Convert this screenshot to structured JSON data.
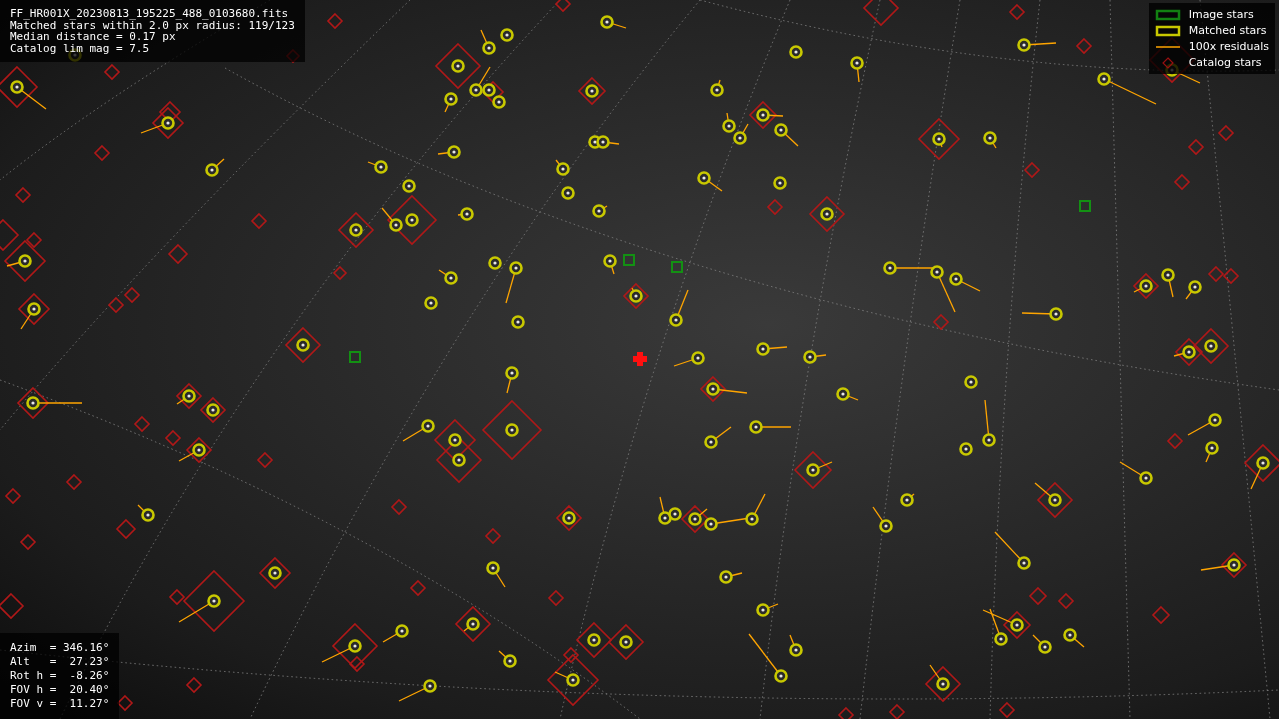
{
  "file_info": {
    "lines": [
      "FF_HR001X_20230813_195225_488_0103680.fits",
      "Matched stars within 2.0 px radius: 119/123",
      "Median distance = 0.17 px",
      "Catalog lim mag = 7.5"
    ]
  },
  "legend": {
    "items": [
      {
        "kind": "image",
        "label": "Image stars"
      },
      {
        "kind": "matched",
        "label": "Matched stars"
      },
      {
        "kind": "residual",
        "label": "100x residuals"
      },
      {
        "kind": "catalog",
        "label": "Catalog stars"
      }
    ]
  },
  "pointing": {
    "lines": [
      "Azim  = 346.16°",
      "Alt   =  27.23°",
      "Rot h =  -8.26°",
      "FOV h =  20.40°",
      "FOV v =  11.27°"
    ]
  }
}
